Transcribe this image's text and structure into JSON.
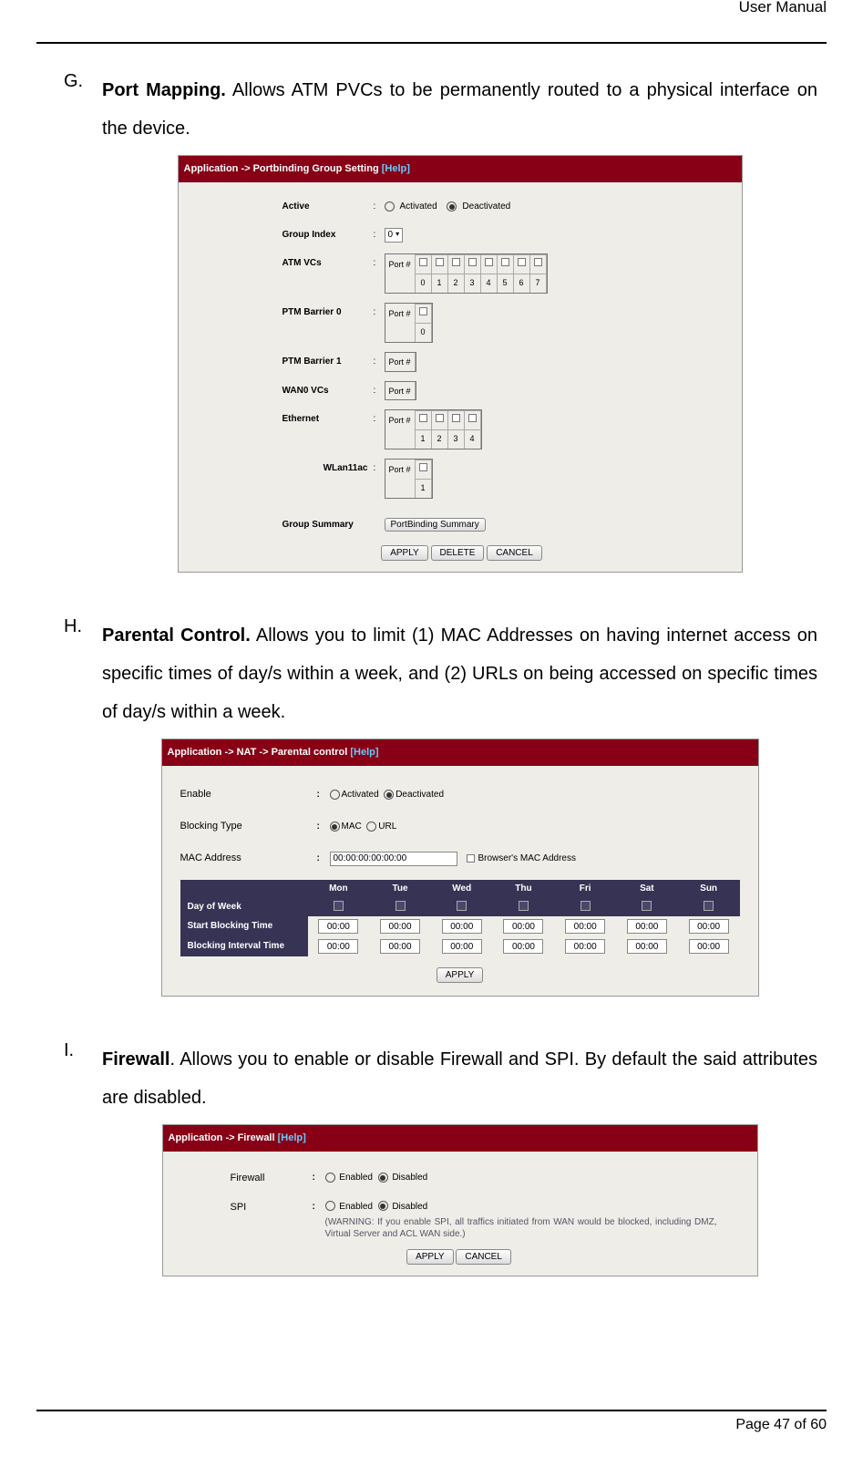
{
  "header": "User Manual",
  "footer": "Page 47 of 60",
  "itemG": {
    "marker": "G.",
    "title": "Port Mapping.",
    "text": " Allows ATM PVCs to be permanently routed to a physical interface on the device."
  },
  "itemH": {
    "marker": "H.",
    "title": "Parental Control.",
    "text": " Allows you to limit (1) MAC Addresses on having internet access on specific times of day/s within a week, and (2) URLs on being accessed on specific times of day/s within a week."
  },
  "itemI": {
    "marker": "I.",
    "title": "Firewall",
    "text": ". Allows you to enable or disable Firewall and SPI. By default the said attributes are disabled."
  },
  "panelG": {
    "title": "Application -> Portbinding Group Setting ",
    "help": "[Help]",
    "labels": {
      "active": "Active",
      "groupIndex": "Group Index",
      "atmVcs": "ATM VCs",
      "ptm0": "PTM Barrier 0",
      "ptm1": "PTM Barrier 1",
      "wan0": "WAN0 VCs",
      "ethernet": "Ethernet",
      "wlan": "WLan11ac ",
      "groupSummary": "Group Summary"
    },
    "activated": "Activated",
    "deactivated": "Deactivated",
    "groupIndexVal": "0",
    "portHash": "Port #",
    "atmPorts": [
      "0",
      "1",
      "2",
      "3",
      "4",
      "5",
      "6",
      "7"
    ],
    "ptm0Ports": [
      "0"
    ],
    "ethPorts": [
      "1",
      "2",
      "3",
      "4"
    ],
    "wlanPorts": [
      "1"
    ],
    "summaryBtn": "PortBinding Summary",
    "btnApply": "APPLY",
    "btnDelete": "DELETE",
    "btnCancel": "CANCEL"
  },
  "panelH": {
    "title": "Application -> NAT -> Parental control ",
    "help": "[Help]",
    "labels": {
      "enable": "Enable",
      "blockingType": "Blocking Type",
      "macAddress": "MAC Address"
    },
    "activated": "Activated",
    "deactivated": "Deactivated",
    "mac": "MAC",
    "url": "URL",
    "macVal": "00:00:00:00:00:00",
    "browserMac": "Browser's MAC Address",
    "days": [
      "Mon",
      "Tue",
      "Wed",
      "Thu",
      "Fri",
      "Sat",
      "Sun"
    ],
    "rowDay": "Day of Week",
    "rowStart": "Start Blocking Time",
    "rowInterval": "Blocking Interval Time",
    "time": "00:00",
    "btnApply": "APPLY"
  },
  "panelI": {
    "title": "Application -> Firewall ",
    "help": "[Help]",
    "labels": {
      "firewall": "Firewall",
      "spi": "SPI"
    },
    "enabled": "Enabled",
    "disabled": "Disabled",
    "warning": "(WARNING: If you enable SPI, all traffics initiated from WAN would be blocked, including DMZ, Virtual Server and ACL WAN side.)",
    "btnApply": "APPLY",
    "btnCancel": "CANCEL"
  }
}
